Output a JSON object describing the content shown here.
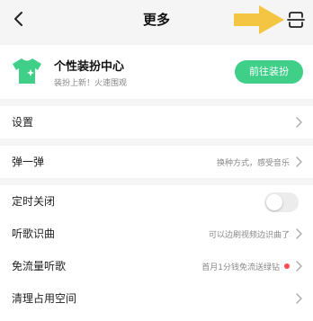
{
  "header": {
    "title": "更多",
    "back_icon": "chevron-left-icon",
    "scan_icon": "scan-icon"
  },
  "promo": {
    "title": "个性装扮中心",
    "subtitle": "装扮上新！火速围观",
    "button_label": "前往装扮",
    "icon": "tshirt-icon",
    "accent_color": "#3fcf88"
  },
  "settings": {
    "label": "设置"
  },
  "tanyitan": {
    "label": "弹一弹",
    "hint": "换种方式，感受音乐"
  },
  "sleep_timer": {
    "label": "定时关闭",
    "enabled": false
  },
  "menu": [
    {
      "label": "听歌识曲",
      "hint": "可以边刷视频边识曲了",
      "dot": false
    },
    {
      "label": "免流量听歌",
      "hint": "首月1分钱免流送绿钻",
      "dot": true
    },
    {
      "label": "清理占用空间",
      "hint": "",
      "dot": false
    }
  ],
  "colors": {
    "background": "#f5f5f5",
    "accent": "#3fcf88",
    "arrow": "#f4c542",
    "badge_dot": "#ff4d4f"
  }
}
